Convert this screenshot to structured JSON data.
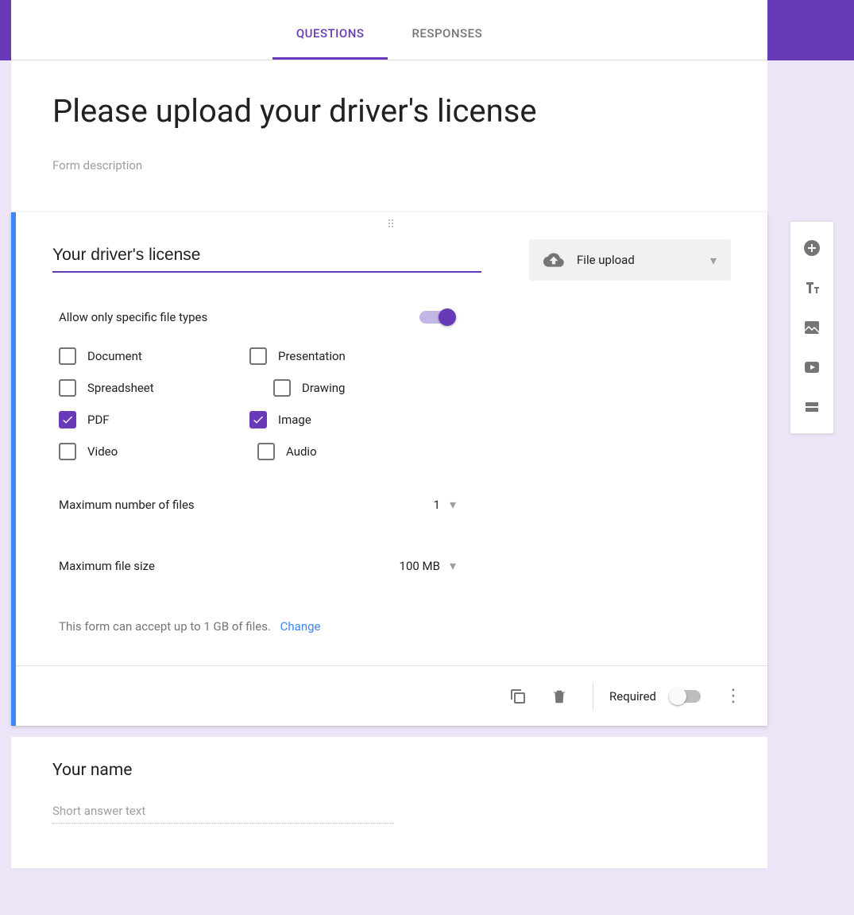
{
  "tabs": {
    "questions": "QUESTIONS",
    "responses": "RESPONSES"
  },
  "header": {
    "title": "Please upload your driver's license",
    "description": "Form description"
  },
  "question": {
    "title": "Your driver's license",
    "type_label": "File upload",
    "allow_specific_label": "Allow only specific file types",
    "allow_specific_on": true,
    "filetypes": {
      "document": "Document",
      "spreadsheet": "Spreadsheet",
      "pdf": "PDF",
      "video": "Video",
      "presentation": "Presentation",
      "drawing": "Drawing",
      "image": "Image",
      "audio": "Audio"
    },
    "checked": {
      "pdf": true,
      "image": true
    },
    "max_files_label": "Maximum number of files",
    "max_files_value": "1",
    "max_size_label": "Maximum file size",
    "max_size_value": "100 MB",
    "limit_text": "This form can accept up to 1 GB of files.",
    "limit_change": "Change",
    "required_label": "Required",
    "required_on": false
  },
  "short_question": {
    "title": "Your name",
    "placeholder": "Short answer text"
  }
}
